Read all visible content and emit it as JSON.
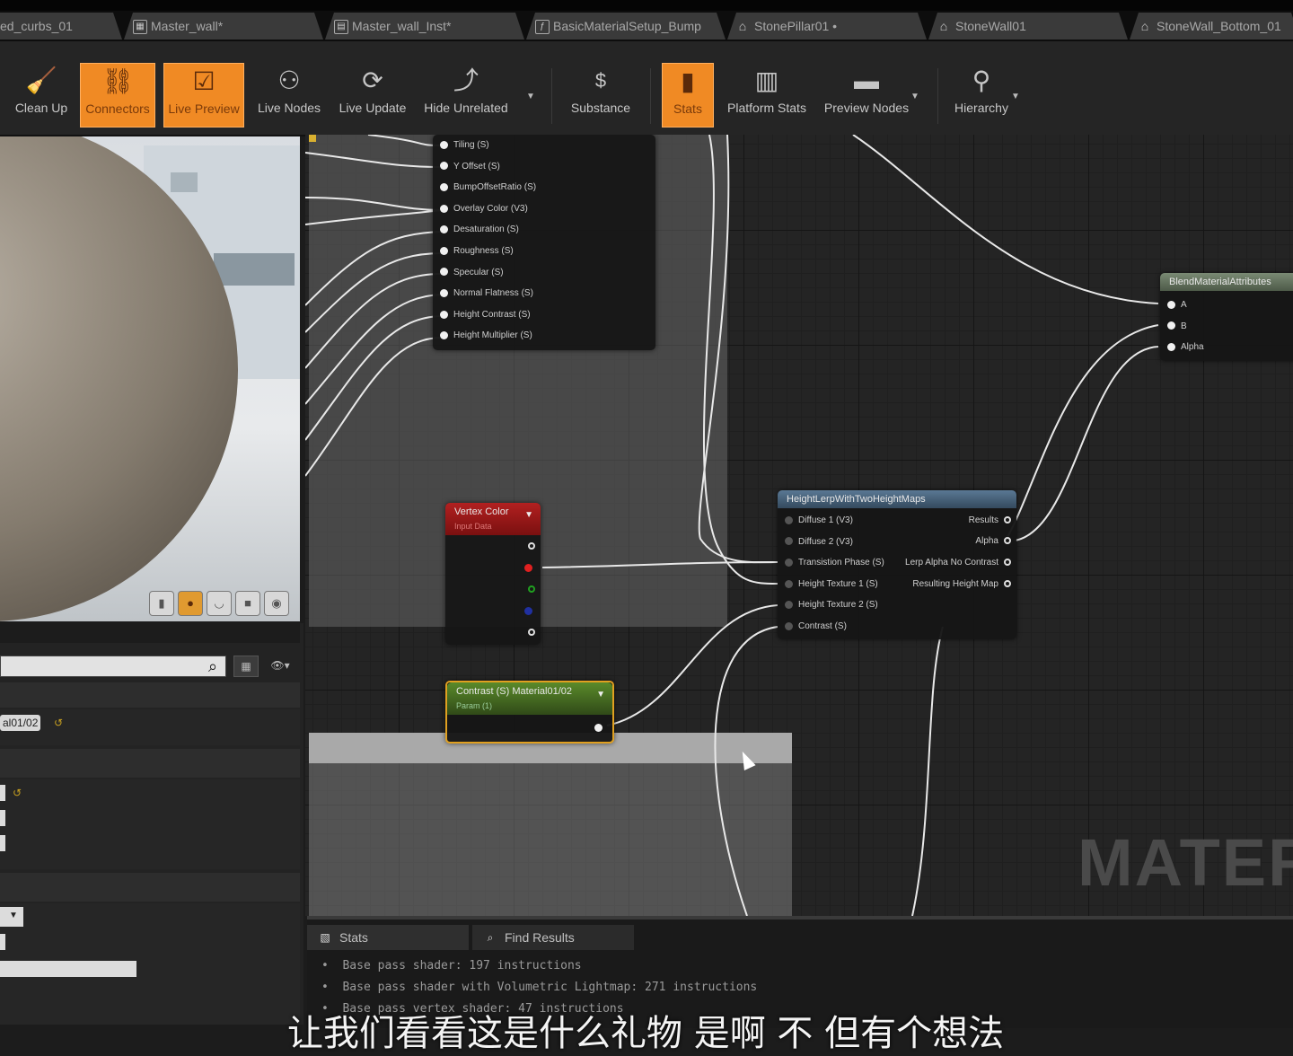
{
  "tabs": [
    {
      "label": "ed_curbs_01",
      "icon": "none"
    },
    {
      "label": "Master_wall*",
      "icon": "material-icon"
    },
    {
      "label": "Master_wall_Inst*",
      "icon": "material-instance-icon"
    },
    {
      "label": "BasicMaterialSetup_Bump",
      "icon": "material-function-icon"
    },
    {
      "label": "StonePillar01 •",
      "icon": "house-icon"
    },
    {
      "label": "StoneWall01",
      "icon": "house-icon"
    },
    {
      "label": "StoneWall_Bottom_01",
      "icon": "house-icon"
    }
  ],
  "toolbar": {
    "clean_up": "Clean Up",
    "connectors": "Connectors",
    "live_preview": "Live Preview",
    "live_nodes": "Live Nodes",
    "live_update": "Live Update",
    "hide_unrelated": "Hide Unrelated",
    "substance": "Substance",
    "stats": "Stats",
    "platform_stats": "Platform Stats",
    "preview_nodes": "Preview Nodes",
    "hierarchy": "Hierarchy"
  },
  "details": {
    "value_pill": "al01/02"
  },
  "graph": {
    "param_node": {
      "pins": [
        "Tiling (S)",
        "Y Offset (S)",
        "BumpOffsetRatio (S)",
        "Overlay Color (V3)",
        "Desaturation (S)",
        "Roughness (S)",
        "Specular (S)",
        "Normal Flatness (S)",
        "Height Contrast (S)",
        "Height Multiplier (S)"
      ]
    },
    "vertex_color": {
      "title": "Vertex Color",
      "subtitle": "Input Data"
    },
    "contrast_param": {
      "title": "Contrast (S) Material01/02",
      "subtitle": "Param (1)"
    },
    "height_lerp": {
      "title": "HeightLerpWithTwoHeightMaps",
      "inputs": [
        "Diffuse 1 (V3)",
        "Diffuse 2 (V3)",
        "Transistion Phase (S)",
        "Height Texture 1 (S)",
        "Height Texture 2 (S)",
        "Contrast (S)"
      ],
      "outputs": [
        "Results",
        "Alpha",
        "Lerp Alpha No Contrast",
        "Resulting Height Map"
      ]
    },
    "blend": {
      "title": "BlendMaterialAttributes",
      "inputs": [
        "A",
        "B",
        "Alpha"
      ]
    },
    "watermark": "MATERIA"
  },
  "bottom": {
    "tab_stats": "Stats",
    "tab_find": "Find Results",
    "lines": [
      "Base pass shader: 197 instructions",
      "Base pass shader with Volumetric Lightmap: 271 instructions",
      "Base pass vertex shader: 47 instructions"
    ]
  },
  "subtitle": "让我们看看这是什么礼物 是啊 不 但有个想法"
}
